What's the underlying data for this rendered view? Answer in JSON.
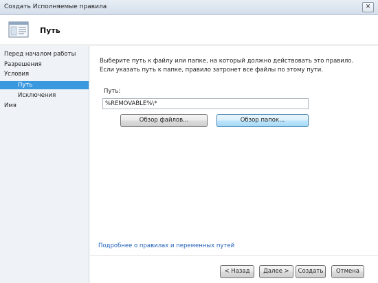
{
  "window": {
    "title": "Создать Исполняемые правила",
    "close_label": "✕"
  },
  "header": {
    "page_title": "Путь",
    "icon": "rule-page-icon"
  },
  "sidebar": {
    "items": [
      {
        "label": "Перед началом работы"
      },
      {
        "label": "Разрешения"
      },
      {
        "label": "Условия"
      },
      {
        "label": "Путь"
      },
      {
        "label": "Исключения"
      },
      {
        "label": "Имя"
      }
    ]
  },
  "main": {
    "description": "Выберите путь к файлу или папке, на который должно действовать это правило. Если указать путь к папке, правило затронет все файлы по этому пути.",
    "path_label": "Путь:",
    "path_value": "%REMOVABLE%\\*",
    "browse_files_label": "Обзор файлов...",
    "browse_folders_label": "Обзор папок...",
    "more_link": "Подробнее о правилах и переменных путей"
  },
  "footer": {
    "back_label": "< Назад",
    "next_label": "Далее >",
    "create_label": "Создать",
    "cancel_label": "Отмена"
  },
  "colors": {
    "selection": "#3a98df",
    "sidebar_bg": "#eff3f8",
    "link": "#1f5fb8"
  }
}
